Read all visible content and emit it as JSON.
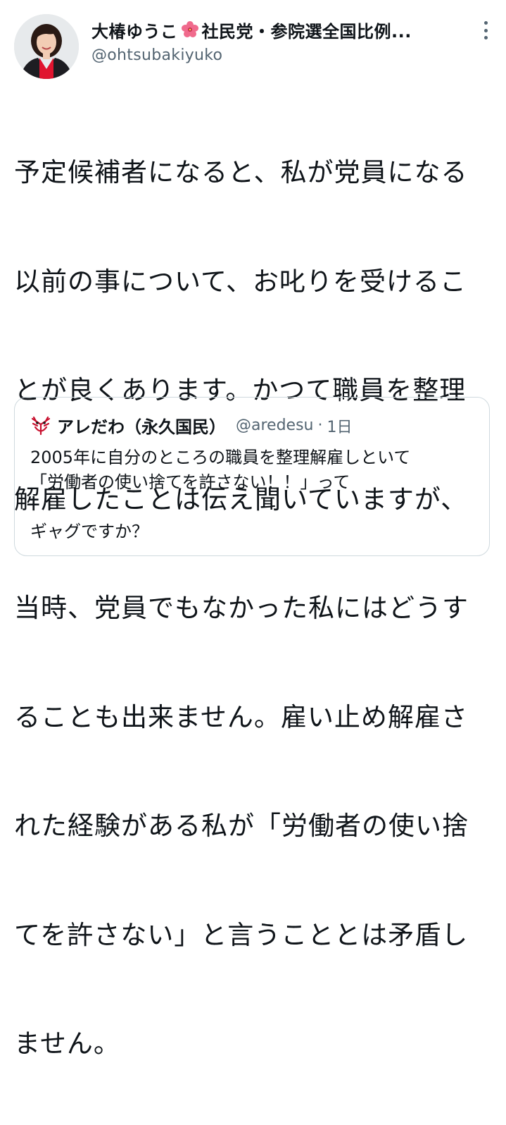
{
  "tweet": {
    "author": {
      "display_name": "大椿ゆうこ",
      "name_suffix": "社民党・参院選全国比例...",
      "handle": "@ohtsubakiyuko"
    },
    "text_lines": [
      "予定候補者になると、私が党員になる",
      "以前の事について、お叱りを受けるこ",
      "とが良くあります。かつて職員を整理",
      "解雇したことは伝え聞いていますが、",
      "当時、党員でもなかった私にはどうす",
      "ることも出来ません。雇い止め解雇さ",
      "れた経験がある私が「労働者の使い捨",
      "てを許さない」と言うこととは矛盾し",
      "ません。"
    ]
  },
  "quoted_tweet": {
    "author": {
      "display_name": "アレだわ（永久国民）",
      "handle": "@aredesu",
      "separator": "·",
      "time": "1日"
    },
    "text": "2005年に自分のところの職員を整理解雇しといて\n「労働者の使い捨てを許さない！！」って\n\nギャグですか？"
  },
  "colors": {
    "text_primary": "#0f1419",
    "text_secondary": "#536471",
    "border": "#cfd9de",
    "flower": "#f06a8c",
    "avatar_shirt": "#e0142f"
  },
  "icons": {
    "flower": "hibiscus-icon",
    "more": "more-options-icon",
    "quote_avatar": "mask-icon"
  }
}
